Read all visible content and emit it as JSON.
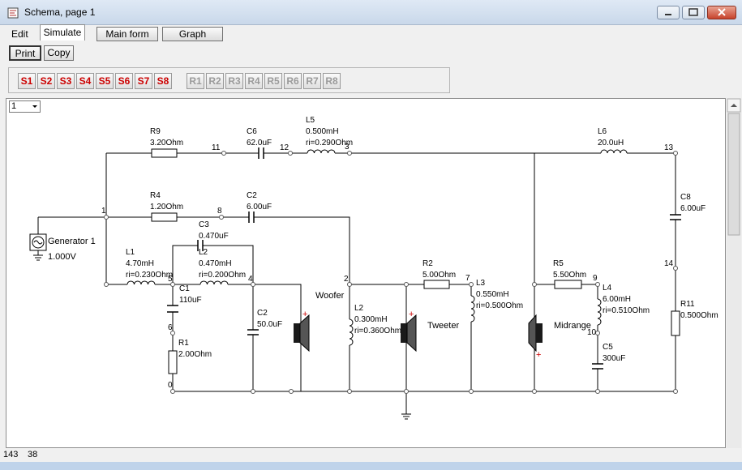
{
  "window": {
    "title": "Schema, page 1"
  },
  "menu": {
    "edit": "Edit",
    "simulate": "Simulate",
    "main_form": "Main form",
    "graph": "Graph"
  },
  "toolbar": {
    "print": "Print",
    "copy": "Copy"
  },
  "s_buttons": [
    "S1",
    "S2",
    "S3",
    "S4",
    "S5",
    "S6",
    "S7",
    "S8"
  ],
  "r_buttons": [
    "R1",
    "R2",
    "R3",
    "R4",
    "R5",
    "R6",
    "R7",
    "R8"
  ],
  "page_select": {
    "value": "1"
  },
  "status": {
    "x": "143",
    "y": "38"
  },
  "colors": {
    "accent": "#cc0000",
    "disabled": "#9a9a9a"
  },
  "schematic": {
    "components": {
      "r9": {
        "name": "R9",
        "value": "3.20Ohm"
      },
      "c6": {
        "name": "C6",
        "value": "62.0uF"
      },
      "l5": {
        "name": "L5",
        "value": "0.500mH",
        "ri": "ri=0.290Ohm"
      },
      "l6": {
        "name": "L6",
        "value": "20.0uH"
      },
      "r4": {
        "name": "R4",
        "value": "1.20Ohm"
      },
      "c2a": {
        "name": "C2",
        "value": "6.00uF"
      },
      "c8": {
        "name": "C8",
        "value": "6.00uF"
      },
      "c3": {
        "name": "C3",
        "value": "0.470uF"
      },
      "gen": {
        "name": "Generator 1",
        "value": "1.000V"
      },
      "l1": {
        "name": "L1",
        "value": "4.70mH",
        "ri": "ri=0.230Ohm"
      },
      "l2a": {
        "name": "L2",
        "value": "0.470mH",
        "ri": "ri=0.200Ohm"
      },
      "c1": {
        "name": "C1",
        "value": "110uF"
      },
      "r1": {
        "name": "R1",
        "value": "2.00Ohm"
      },
      "c2b": {
        "name": "C2",
        "value": "50.0uF"
      },
      "l2b": {
        "name": "L2",
        "value": "0.300mH",
        "ri": "ri=0.360Ohm"
      },
      "r2": {
        "name": "R2",
        "value": "5.00Ohm"
      },
      "l3": {
        "name": "L3",
        "value": "0.550mH",
        "ri": "ri=0.500Ohm"
      },
      "r5": {
        "name": "R5",
        "value": "5.50Ohm"
      },
      "l4": {
        "name": "L4",
        "value": "6.00mH",
        "ri": "ri=0.510Ohm"
      },
      "c5": {
        "name": "C5",
        "value": "300uF"
      },
      "r11": {
        "name": "R11",
        "value": "0.500Ohm"
      }
    },
    "nodes": {
      "n0": "0",
      "n1": "1",
      "n2": "2",
      "n3": "3",
      "n4": "4",
      "n5": "5",
      "n6": "6",
      "n7": "7",
      "n8": "8",
      "n9": "9",
      "n10": "10",
      "n11": "11",
      "n12": "12",
      "n13": "13",
      "n14": "14"
    },
    "speakers": {
      "woofer": "Woofer",
      "tweeter": "Tweeter",
      "midrange": "Midrange"
    }
  }
}
